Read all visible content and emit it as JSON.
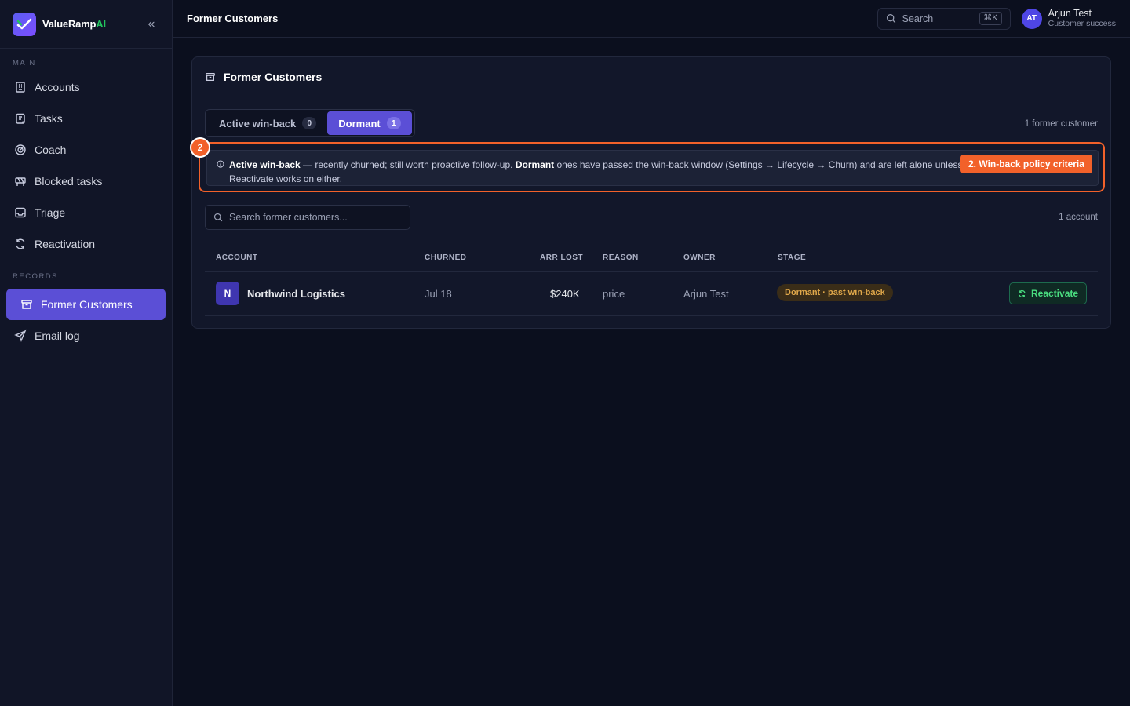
{
  "brand": {
    "name": "ValueRamp",
    "name_accent": "AI"
  },
  "sidebar": {
    "main_label": "MAIN",
    "main_items": [
      {
        "label": "Accounts",
        "icon": "building-icon"
      },
      {
        "label": "Tasks",
        "icon": "clipboard-icon"
      },
      {
        "label": "Coach",
        "icon": "target-icon"
      },
      {
        "label": "Blocked tasks",
        "icon": "blocked-icon"
      },
      {
        "label": "Triage",
        "icon": "inbox-icon"
      },
      {
        "label": "Reactivation",
        "icon": "refresh-icon"
      }
    ],
    "records_label": "RECORDS",
    "records_items": [
      {
        "label": "Former Customers",
        "icon": "archive-icon",
        "active": true
      },
      {
        "label": "Email log",
        "icon": "send-icon"
      }
    ]
  },
  "topbar": {
    "title": "Former Customers",
    "search_label": "Search",
    "search_shortcut": "⌘K",
    "user": {
      "initials": "AT",
      "name": "Arjun Test",
      "role": "Customer success"
    }
  },
  "card": {
    "title": "Former Customers",
    "tabs": [
      {
        "label": "Active win-back",
        "count": "0",
        "active": false
      },
      {
        "label": "Dormant",
        "count": "1",
        "active": true
      }
    ],
    "count_summary": "1 former customer",
    "info": {
      "term_active": "Active win-back",
      "text_active": " — recently churned; still worth proactive follow-up. ",
      "term_dormant": "Dormant",
      "text_dormant": " ones have passed the win-back window (Settings → Lifecycle → Churn) and are left alone unless they re-engage.",
      "line2": "Reactivate works on either."
    },
    "annotation": {
      "number": "2",
      "label": "2. Win-back policy criteria"
    },
    "search_placeholder": "Search former customers...",
    "account_count": "1 account",
    "table": {
      "headers": [
        "ACCOUNT",
        "CHURNED",
        "ARR LOST",
        "REASON",
        "OWNER",
        "STAGE"
      ],
      "rows": [
        {
          "initial": "N",
          "account": "Northwind Logistics",
          "churned": "Jul 18",
          "arr_lost": "$240K",
          "reason": "price",
          "owner": "Arjun Test",
          "stage": "Dormant · past win-back",
          "action": "Reactivate"
        }
      ]
    }
  },
  "colors": {
    "accent": "#5b4fd6",
    "annotation": "#f2612a",
    "success": "#4ade80",
    "warning": "#e0a84a"
  }
}
